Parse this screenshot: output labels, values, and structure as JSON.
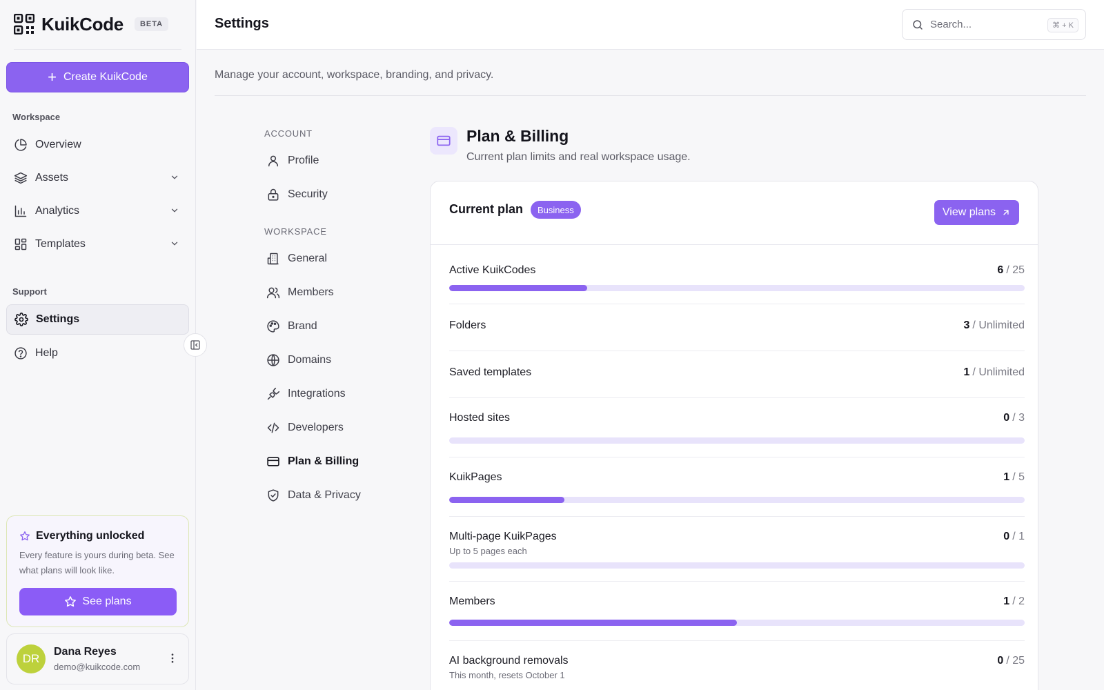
{
  "app": {
    "name": "KuikCode",
    "badge": "BETA"
  },
  "sidebar": {
    "create_label": "Create KuikCode",
    "workspace_label": "Workspace",
    "support_label": "Support",
    "items": [
      {
        "label": "Overview",
        "icon": "pie-chart-icon"
      },
      {
        "label": "Assets",
        "icon": "layers-icon"
      },
      {
        "label": "Analytics",
        "icon": "bar-chart-icon"
      },
      {
        "label": "Templates",
        "icon": "layout-grid-icon"
      },
      {
        "label": "Settings",
        "icon": "gear-icon"
      },
      {
        "label": "Help",
        "icon": "help-circle-icon"
      }
    ],
    "promo": {
      "title": "Everything unlocked",
      "body": "Every feature is yours during beta. See what plans will look like.",
      "button": "See plans"
    },
    "user": {
      "initials": "DR",
      "name": "Dana Reyes",
      "email": "demo@kuikcode.com"
    }
  },
  "header": {
    "title": "Settings",
    "search_placeholder": "Search...",
    "search_shortcut": "⌘ + K"
  },
  "subtitle": "Manage your account, workspace, branding, and privacy.",
  "settings_nav": {
    "account_label": "ACCOUNT",
    "workspace_label": "WORKSPACE",
    "account_items": [
      {
        "label": "Profile",
        "icon": "user-icon"
      },
      {
        "label": "Security",
        "icon": "lock-icon"
      }
    ],
    "workspace_items": [
      {
        "label": "General",
        "icon": "building-icon"
      },
      {
        "label": "Members",
        "icon": "users-icon"
      },
      {
        "label": "Brand",
        "icon": "palette-icon"
      },
      {
        "label": "Domains",
        "icon": "globe-icon"
      },
      {
        "label": "Integrations",
        "icon": "plug-icon"
      },
      {
        "label": "Developers",
        "icon": "code-icon"
      },
      {
        "label": "Plan & Billing",
        "icon": "credit-card-icon"
      },
      {
        "label": "Data & Privacy",
        "icon": "shield-check-icon"
      }
    ]
  },
  "section": {
    "title": "Plan & Billing",
    "subtitle": "Current plan limits and real workspace usage."
  },
  "plan": {
    "heading": "Current plan",
    "badge": "Business",
    "view_plans": "View plans",
    "usage": [
      {
        "label": "Active KuikCodes",
        "note": "",
        "used": "6",
        "limit": "/ 25",
        "fraction": 0.24
      },
      {
        "label": "Folders",
        "note": "",
        "used": "3",
        "limit": "/ Unlimited",
        "fraction": null
      },
      {
        "label": "Saved templates",
        "note": "",
        "used": "1",
        "limit": "/ Unlimited",
        "fraction": null
      },
      {
        "label": "Hosted sites",
        "note": "",
        "used": "0",
        "limit": "/ 3",
        "fraction": 0
      },
      {
        "label": "KuikPages",
        "note": "",
        "used": "1",
        "limit": "/ 5",
        "fraction": 0.2
      },
      {
        "label": "Multi-page KuikPages",
        "note": "Up to 5 pages each",
        "used": "0",
        "limit": "/ 1",
        "fraction": 0
      },
      {
        "label": "Members",
        "note": "",
        "used": "1",
        "limit": "/ 2",
        "fraction": 0.5
      },
      {
        "label": "AI background removals",
        "note": "This month, resets October 1",
        "used": "0",
        "limit": "/ 25",
        "fraction": 0
      }
    ]
  },
  "colors": {
    "accent": "#8b63f0",
    "bar_track": "#e8e3fb",
    "avatar": "#bdd13c"
  }
}
